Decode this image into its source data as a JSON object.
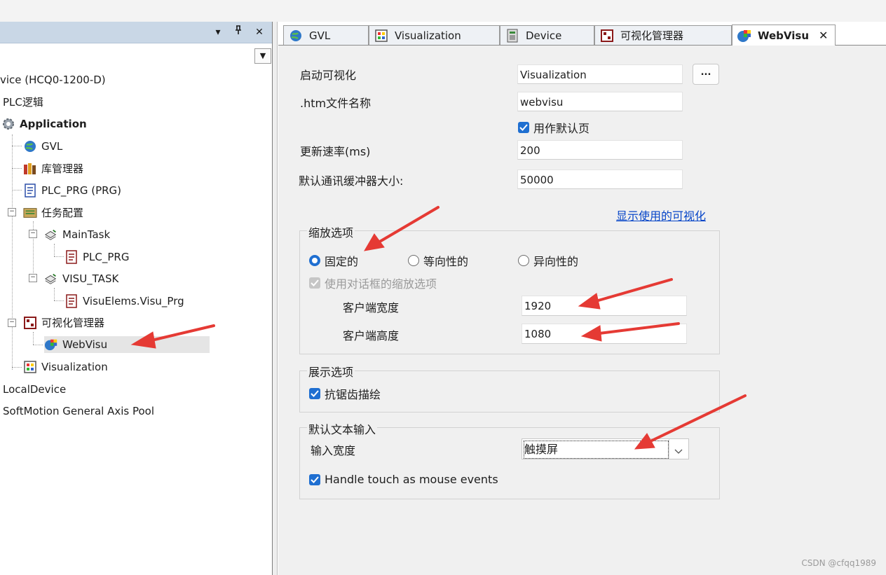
{
  "left_panel": {
    "header_buttons": {
      "dropdown": "▾",
      "pin": "ᵻ",
      "close": "✕"
    },
    "tree": [
      {
        "label": "vice (HCQ0-1200-D)",
        "icon": "device-icon"
      },
      {
        "label": "PLC逻辑",
        "icon": "plc-logic-icon"
      },
      {
        "label": "Application",
        "icon": "gear-icon"
      },
      {
        "label": "GVL",
        "icon": "globe-icon"
      },
      {
        "label": "库管理器",
        "icon": "library-icon"
      },
      {
        "label": "PLC_PRG (PRG)",
        "icon": "program-icon"
      },
      {
        "label": "任务配置",
        "icon": "task-config-icon"
      },
      {
        "label": "MainTask",
        "icon": "task-icon"
      },
      {
        "label": "PLC_PRG",
        "icon": "program-call-icon"
      },
      {
        "label": "VISU_TASK",
        "icon": "task-icon"
      },
      {
        "label": "VisuElems.Visu_Prg",
        "icon": "program-call-icon"
      },
      {
        "label": "可视化管理器",
        "icon": "visu-manager-icon"
      },
      {
        "label": "WebVisu",
        "icon": "webvisu-icon"
      },
      {
        "label": "Visualization",
        "icon": "visualization-icon"
      },
      {
        "label": "LocalDevice",
        "icon": "none"
      },
      {
        "label": "SoftMotion General Axis Pool",
        "icon": "none"
      }
    ]
  },
  "tabs": [
    {
      "label": "GVL",
      "icon": "globe-icon"
    },
    {
      "label": "Visualization",
      "icon": "visualization-icon"
    },
    {
      "label": "Device",
      "icon": "device-icon"
    },
    {
      "label": "可视化管理器",
      "icon": "visu-manager-icon"
    },
    {
      "label": "WebVisu",
      "icon": "webvisu-icon",
      "active": true,
      "close": "✕"
    }
  ],
  "form": {
    "start_visu_label": "启动可视化",
    "start_visu_value": "Visualization",
    "browse_label": "...",
    "htm_label": ".htm文件名称",
    "htm_value": "webvisu",
    "default_page_label": "用作默认页",
    "default_page_checked": true,
    "update_rate_label": "更新速率(ms)",
    "update_rate_value": "200",
    "buffer_label": "默认通讯缓冲器大小:",
    "buffer_value": "50000",
    "show_used_link": "显示使用的可视化"
  },
  "scaling": {
    "title": "缩放选项",
    "options": [
      "固定的",
      "等向性的",
      "异向性的"
    ],
    "selected": "固定的",
    "dialog_scaling_label": "使用对话框的缩放选项",
    "client_width_label": "客户端宽度",
    "client_width_value": "1920",
    "client_height_label": "客户端高度",
    "client_height_value": "1080"
  },
  "display": {
    "title": "展示选项",
    "antialias_label": "抗锯齿描绘",
    "antialias_checked": true
  },
  "text_input": {
    "title": "默认文本输入",
    "input_width_label": "输入宽度",
    "input_width_value": "触摸屏",
    "handle_touch_label": "Handle touch as mouse events",
    "handle_touch_checked": true
  },
  "colors": {
    "accent": "#1f6fd1",
    "arrow": "#e53a34",
    "link": "#0645c8",
    "panel_header": "#c9d7e6"
  },
  "watermark": "CSDN @cfqq1989"
}
